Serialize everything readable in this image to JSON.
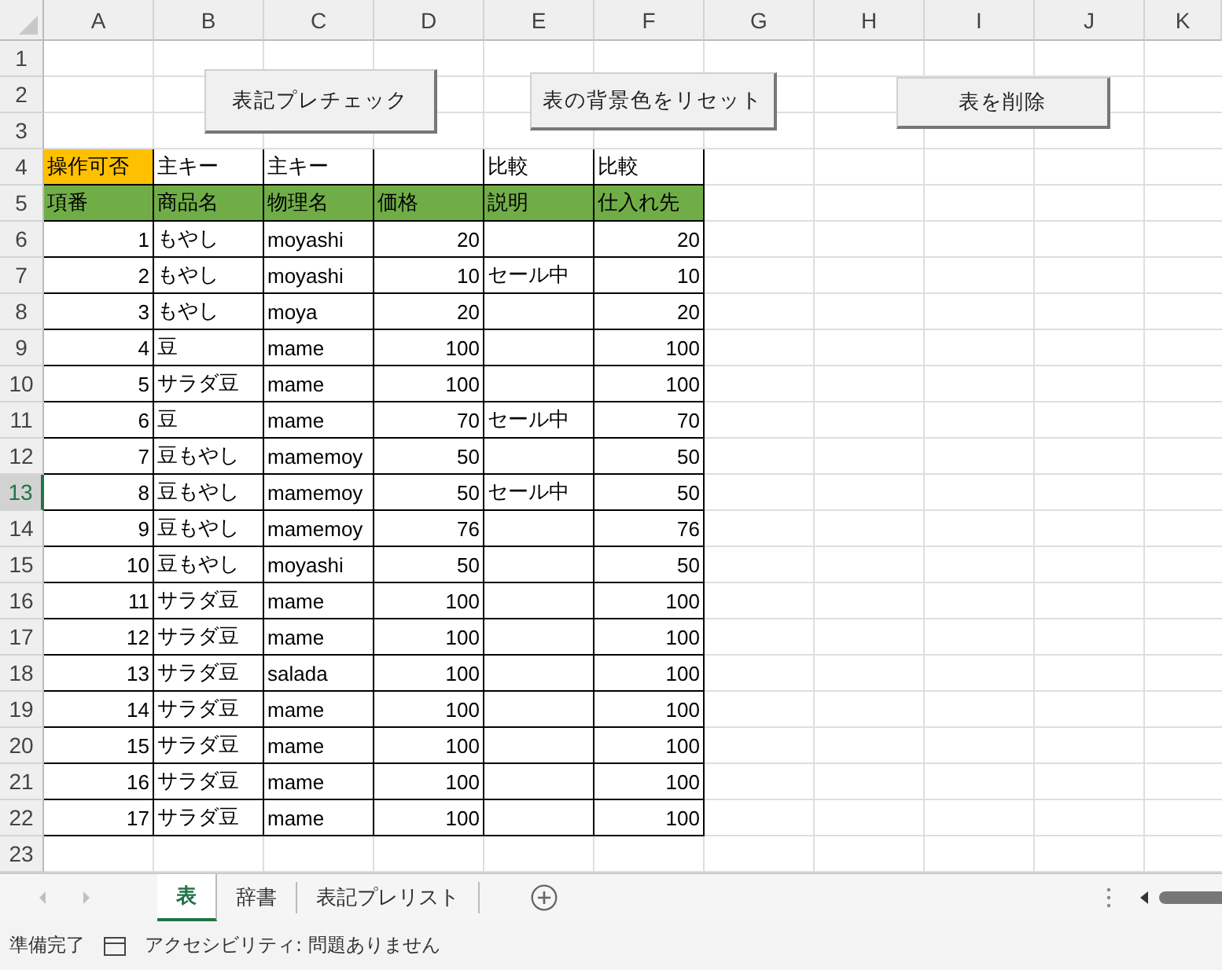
{
  "columns": [
    "A",
    "B",
    "C",
    "D",
    "E",
    "F",
    "G",
    "H",
    "I",
    "J",
    "K"
  ],
  "buttons": [
    {
      "label": "表記プレチェック"
    },
    {
      "label": "表の背景色をリセット"
    },
    {
      "label": "表を削除"
    }
  ],
  "rows": [
    {
      "number": "1",
      "selected": false,
      "cells": []
    },
    {
      "number": "2",
      "selected": false,
      "cells": []
    },
    {
      "number": "3",
      "selected": false,
      "cells": []
    },
    {
      "number": "4",
      "selected": false,
      "cells": [
        {
          "kind": "flag",
          "text": "操作可否"
        },
        {
          "kind": "text",
          "text": "主キー"
        },
        {
          "kind": "text",
          "text": "主キー"
        },
        {
          "kind": "text"
        },
        {
          "kind": "text",
          "text": "比較"
        },
        {
          "kind": "text",
          "text": "比較"
        }
      ]
    },
    {
      "number": "5",
      "selected": false,
      "cells": [
        {
          "kind": "heading",
          "text": "項番"
        },
        {
          "kind": "heading",
          "text": "商品名"
        },
        {
          "kind": "heading",
          "text": "物理名"
        },
        {
          "kind": "heading",
          "text": "価格"
        },
        {
          "kind": "heading",
          "text": "説明"
        },
        {
          "kind": "heading",
          "text": "仕入れ先"
        }
      ]
    },
    {
      "number": "6",
      "selected": false,
      "cells": [
        {
          "kind": "number",
          "text": "1"
        },
        {
          "kind": "text",
          "text": "もやし"
        },
        {
          "kind": "text",
          "text": "moyashi"
        },
        {
          "kind": "number",
          "text": "20"
        },
        {
          "kind": "text"
        },
        {
          "kind": "number",
          "text": "20"
        }
      ]
    },
    {
      "number": "7",
      "selected": false,
      "cells": [
        {
          "kind": "number",
          "text": "2"
        },
        {
          "kind": "text",
          "text": "もやし"
        },
        {
          "kind": "text",
          "text": "moyashi"
        },
        {
          "kind": "number",
          "text": "10"
        },
        {
          "kind": "text",
          "text": "セール中"
        },
        {
          "kind": "number",
          "text": "10"
        }
      ]
    },
    {
      "number": "8",
      "selected": false,
      "cells": [
        {
          "kind": "number",
          "text": "3"
        },
        {
          "kind": "text",
          "text": "もやし"
        },
        {
          "kind": "text",
          "text": "moya"
        },
        {
          "kind": "number",
          "text": "20"
        },
        {
          "kind": "text"
        },
        {
          "kind": "number",
          "text": "20"
        }
      ]
    },
    {
      "number": "9",
      "selected": false,
      "cells": [
        {
          "kind": "number",
          "text": "4"
        },
        {
          "kind": "text",
          "text": "豆"
        },
        {
          "kind": "text",
          "text": "mame"
        },
        {
          "kind": "number",
          "text": "100"
        },
        {
          "kind": "text"
        },
        {
          "kind": "number",
          "text": "100"
        }
      ]
    },
    {
      "number": "10",
      "selected": false,
      "cells": [
        {
          "kind": "number",
          "text": "5"
        },
        {
          "kind": "text",
          "text": "サラダ豆"
        },
        {
          "kind": "text",
          "text": "mame"
        },
        {
          "kind": "number",
          "text": "100"
        },
        {
          "kind": "text"
        },
        {
          "kind": "number",
          "text": "100"
        }
      ]
    },
    {
      "number": "11",
      "selected": false,
      "cells": [
        {
          "kind": "number",
          "text": "6"
        },
        {
          "kind": "text",
          "text": "豆"
        },
        {
          "kind": "text",
          "text": "mame"
        },
        {
          "kind": "number",
          "text": "70"
        },
        {
          "kind": "text",
          "text": "セール中"
        },
        {
          "kind": "number",
          "text": "70"
        }
      ]
    },
    {
      "number": "12",
      "selected": false,
      "cells": [
        {
          "kind": "number",
          "text": "7"
        },
        {
          "kind": "text",
          "text": "豆もやし"
        },
        {
          "kind": "text",
          "text": "mamemoy"
        },
        {
          "kind": "number",
          "text": "50"
        },
        {
          "kind": "text"
        },
        {
          "kind": "number",
          "text": "50"
        }
      ]
    },
    {
      "number": "13",
      "selected": true,
      "cells": [
        {
          "kind": "number",
          "text": "8"
        },
        {
          "kind": "text",
          "text": "豆もやし"
        },
        {
          "kind": "text",
          "text": "mamemoy"
        },
        {
          "kind": "number",
          "text": "50"
        },
        {
          "kind": "text",
          "text": "セール中"
        },
        {
          "kind": "number",
          "text": "50"
        }
      ]
    },
    {
      "number": "14",
      "selected": false,
      "cells": [
        {
          "kind": "number",
          "text": "9"
        },
        {
          "kind": "text",
          "text": "豆もやし"
        },
        {
          "kind": "text",
          "text": "mamemoy"
        },
        {
          "kind": "number",
          "text": "76"
        },
        {
          "kind": "text"
        },
        {
          "kind": "number",
          "text": "76"
        }
      ]
    },
    {
      "number": "15",
      "selected": false,
      "cells": [
        {
          "kind": "number",
          "text": "10"
        },
        {
          "kind": "text",
          "text": "豆もやし"
        },
        {
          "kind": "text",
          "text": "moyashi"
        },
        {
          "kind": "number",
          "text": "50"
        },
        {
          "kind": "text"
        },
        {
          "kind": "number",
          "text": "50"
        }
      ]
    },
    {
      "number": "16",
      "selected": false,
      "cells": [
        {
          "kind": "number",
          "text": "11"
        },
        {
          "kind": "text",
          "text": "サラダ豆"
        },
        {
          "kind": "text",
          "text": "mame"
        },
        {
          "kind": "number",
          "text": "100"
        },
        {
          "kind": "text"
        },
        {
          "kind": "number",
          "text": "100"
        }
      ]
    },
    {
      "number": "17",
      "selected": false,
      "cells": [
        {
          "kind": "number",
          "text": "12"
        },
        {
          "kind": "text",
          "text": "サラダ豆"
        },
        {
          "kind": "text",
          "text": "mame"
        },
        {
          "kind": "number",
          "text": "100"
        },
        {
          "kind": "text"
        },
        {
          "kind": "number",
          "text": "100"
        }
      ]
    },
    {
      "number": "18",
      "selected": false,
      "cells": [
        {
          "kind": "number",
          "text": "13"
        },
        {
          "kind": "text",
          "text": "サラダ豆"
        },
        {
          "kind": "text",
          "text": "salada"
        },
        {
          "kind": "number",
          "text": "100"
        },
        {
          "kind": "text"
        },
        {
          "kind": "number",
          "text": "100"
        }
      ]
    },
    {
      "number": "19",
      "selected": false,
      "cells": [
        {
          "kind": "number",
          "text": "14"
        },
        {
          "kind": "text",
          "text": "サラダ豆"
        },
        {
          "kind": "text",
          "text": "mame"
        },
        {
          "kind": "number",
          "text": "100"
        },
        {
          "kind": "text"
        },
        {
          "kind": "number",
          "text": "100"
        }
      ]
    },
    {
      "number": "20",
      "selected": false,
      "cells": [
        {
          "kind": "number",
          "text": "15"
        },
        {
          "kind": "text",
          "text": "サラダ豆"
        },
        {
          "kind": "text",
          "text": "mame"
        },
        {
          "kind": "number",
          "text": "100"
        },
        {
          "kind": "text"
        },
        {
          "kind": "number",
          "text": "100"
        }
      ]
    },
    {
      "number": "21",
      "selected": false,
      "cells": [
        {
          "kind": "number",
          "text": "16"
        },
        {
          "kind": "text",
          "text": "サラダ豆"
        },
        {
          "kind": "text",
          "text": "mame"
        },
        {
          "kind": "number",
          "text": "100"
        },
        {
          "kind": "text"
        },
        {
          "kind": "number",
          "text": "100"
        }
      ]
    },
    {
      "number": "22",
      "selected": false,
      "cells": [
        {
          "kind": "number",
          "text": "17"
        },
        {
          "kind": "text",
          "text": "サラダ豆"
        },
        {
          "kind": "text",
          "text": "mame"
        },
        {
          "kind": "number",
          "text": "100"
        },
        {
          "kind": "text"
        },
        {
          "kind": "number",
          "text": "100"
        }
      ]
    },
    {
      "number": "23",
      "selected": false,
      "cells": []
    }
  ],
  "sheet_tabs": [
    {
      "label": "表",
      "selected": true
    },
    {
      "label": "辞書",
      "selected": false
    },
    {
      "label": "表記プレリスト",
      "selected": false
    }
  ],
  "status_bar": {
    "ready": "準備完了",
    "accessibility": "アクセシビリティ: 問題ありません"
  }
}
